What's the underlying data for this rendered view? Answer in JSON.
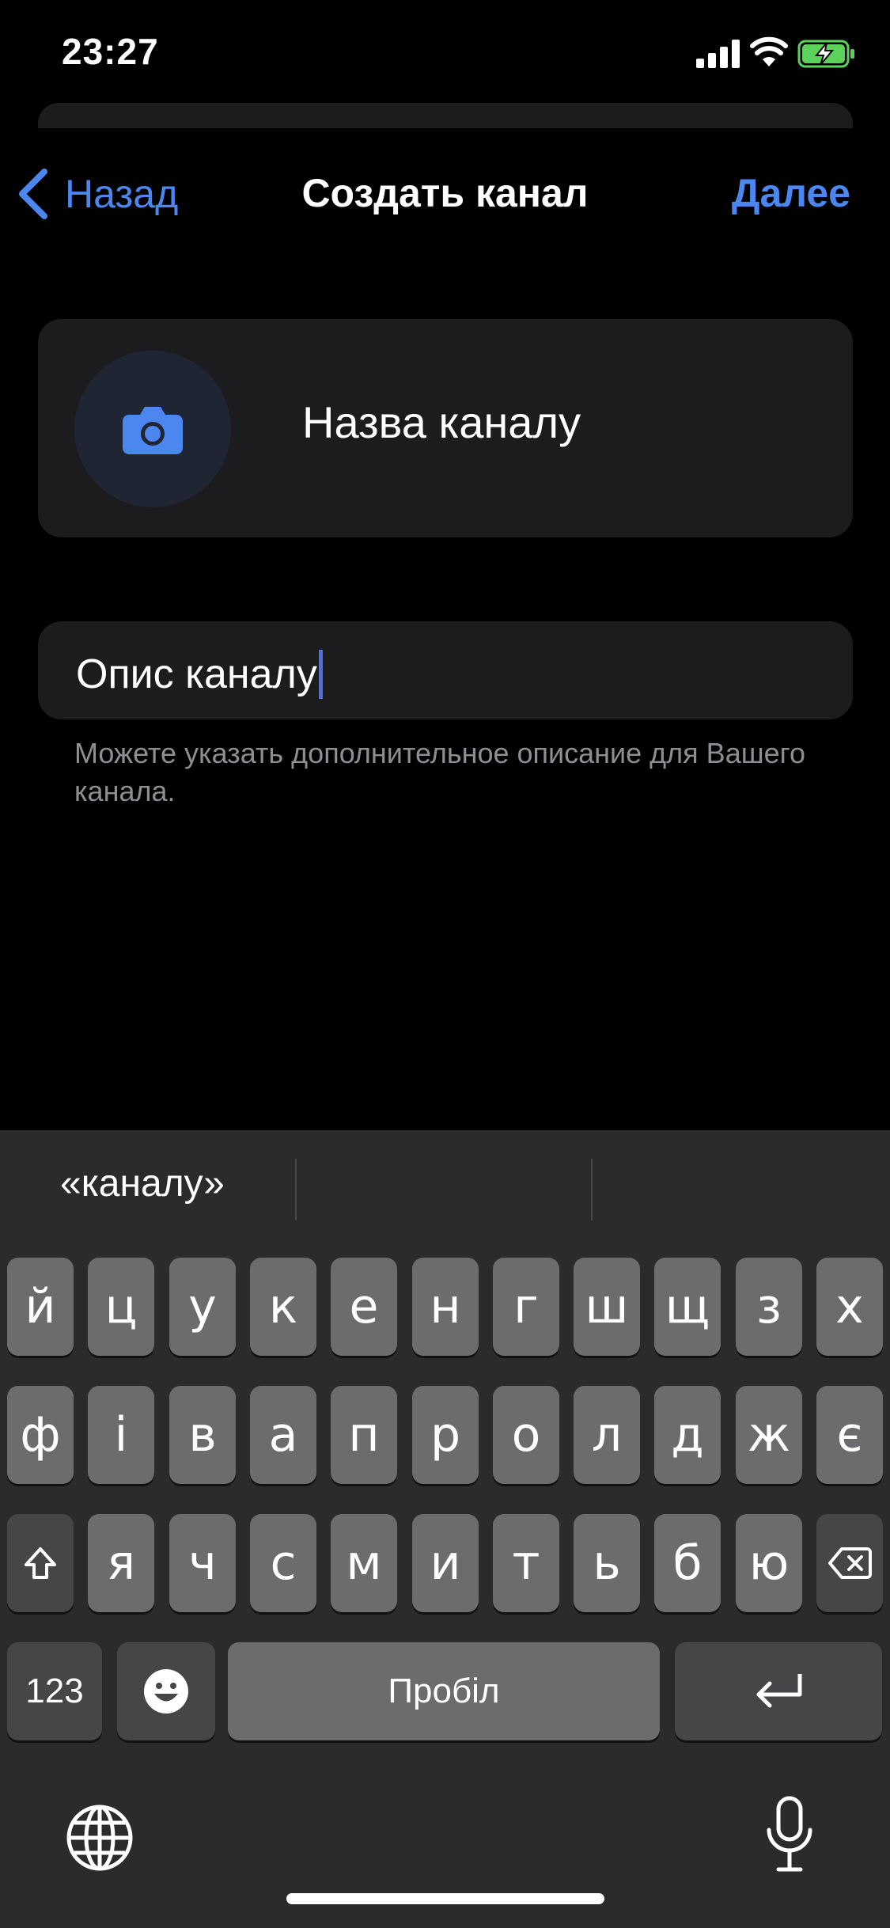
{
  "status_bar": {
    "time": "23:27"
  },
  "nav": {
    "back_label": "Назад",
    "title": "Создать канал",
    "next_label": "Далее"
  },
  "channel": {
    "name_placeholder": "Назва каналу",
    "description_value": "Опис каналу",
    "description_hint": "Можете указать дополнительное описание для Вашего канала."
  },
  "keyboard": {
    "suggestion": "«каналу»",
    "rows": [
      [
        "й",
        "ц",
        "у",
        "к",
        "е",
        "н",
        "г",
        "ш",
        "щ",
        "з",
        "х"
      ],
      [
        "ф",
        "і",
        "в",
        "а",
        "п",
        "р",
        "о",
        "л",
        "д",
        "ж",
        "є"
      ],
      [
        "я",
        "ч",
        "с",
        "м",
        "и",
        "т",
        "ь",
        "б",
        "ю"
      ]
    ],
    "numbers_label": "123",
    "space_label": "Пробіл"
  },
  "colors": {
    "accent": "#4c86ef",
    "background": "#000000",
    "card": "#1c1c1e",
    "battery_charging": "#5bd25a"
  },
  "icons": [
    "chevron-left-icon",
    "camera-icon",
    "shift-icon",
    "backspace-icon",
    "emoji-icon",
    "return-icon",
    "globe-icon",
    "microphone-icon"
  ]
}
